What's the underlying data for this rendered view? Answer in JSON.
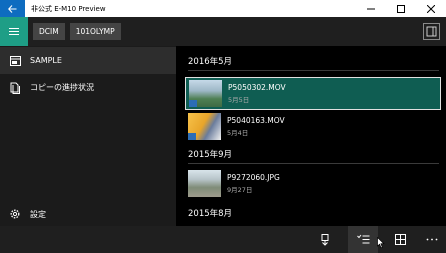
{
  "titlebar": {
    "title": "非公式 E-M10 Preview"
  },
  "toolbar": {
    "breadcrumbs": [
      "DCIM",
      "101OLYMP"
    ]
  },
  "sidebar": {
    "items": [
      {
        "label": "SAMPLE",
        "icon": "sd-card-icon"
      },
      {
        "label": "コピーの進捗状況",
        "icon": "copy-icon"
      }
    ],
    "settings_label": "設定"
  },
  "content": {
    "groups": [
      {
        "header": "2016年5月",
        "items": [
          {
            "name": "P5050302.MOV",
            "date": "5月5日",
            "selected": true
          },
          {
            "name": "P5040163.MOV",
            "date": "5月4日",
            "selected": false
          }
        ]
      },
      {
        "header": "2015年9月",
        "items": [
          {
            "name": "P9272060.JPG",
            "date": "9月27日",
            "selected": false
          }
        ]
      },
      {
        "header": "2015年8月",
        "items": []
      }
    ]
  },
  "colors": {
    "accent": "#0e6cc0",
    "hamburger": "#1e9e86",
    "selected": "#0f5d52"
  }
}
